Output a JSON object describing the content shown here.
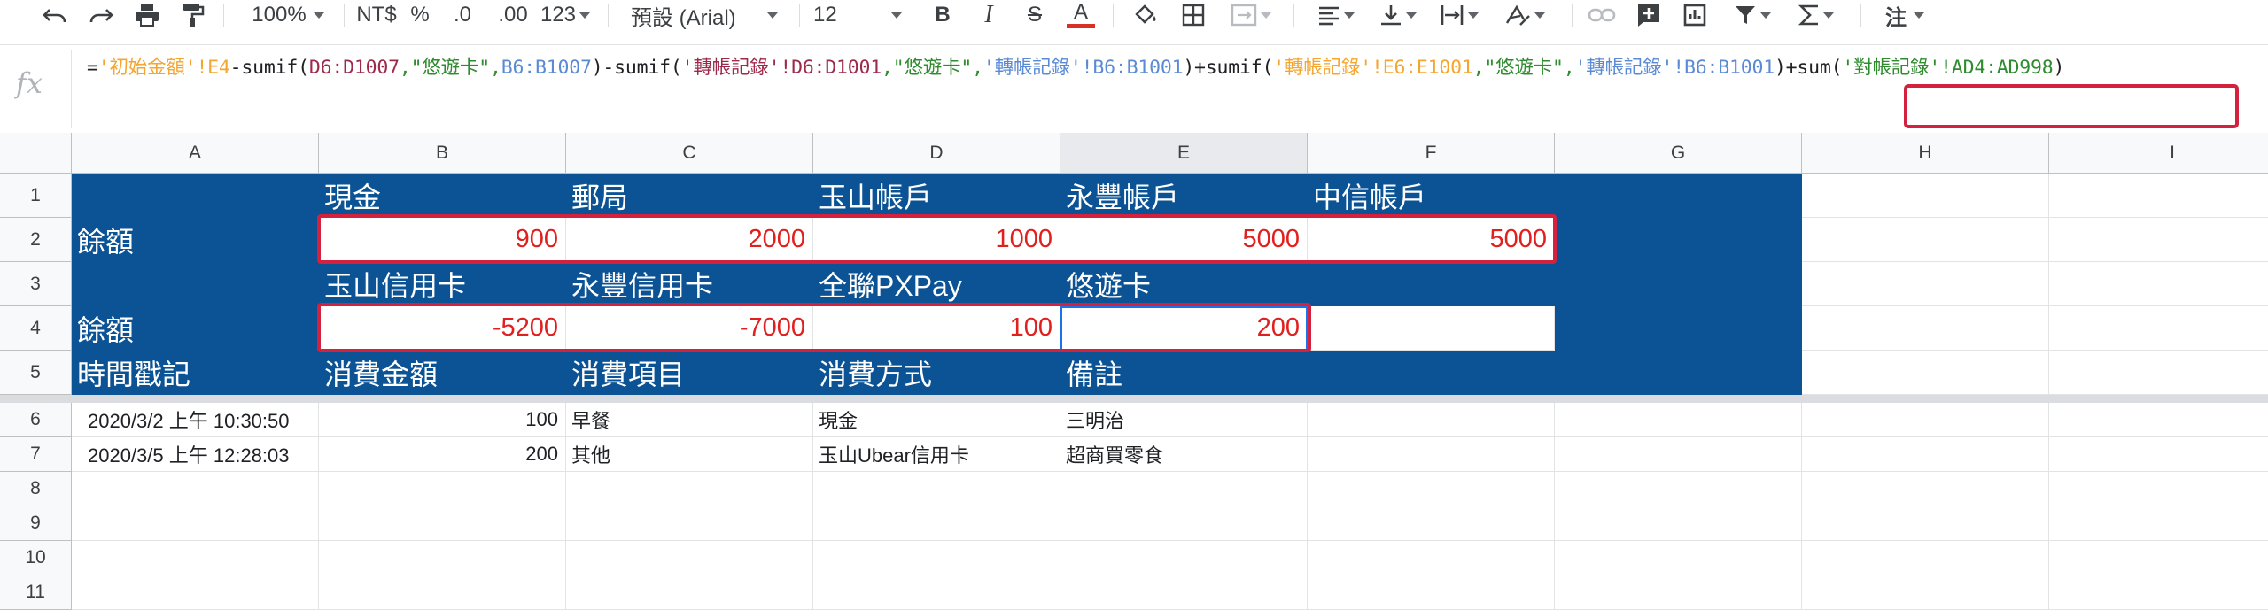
{
  "toolbar": {
    "zoom": "100%",
    "currency": "NT$",
    "percent": "%",
    "decimal_decrease": ".0",
    "decimal_increase": ".00",
    "more_formats": "123",
    "font": "預設 (Arial)",
    "font_size": "12",
    "bold": "B",
    "italic": "I",
    "strike": "S",
    "text_color_letter": "A",
    "text_color": "#d93025",
    "more": "注"
  },
  "formula_bar": {
    "fx_label": "fx",
    "segments": [
      {
        "text": "=",
        "c": "d"
      },
      {
        "text": "'初始金額'!E4",
        "c": "y"
      },
      {
        "text": "-sumif(",
        "c": "d"
      },
      {
        "text": "D6:D1007",
        "c": "m"
      },
      {
        "text": ",\"悠遊卡\",",
        "c": "g"
      },
      {
        "text": "B6:B1007",
        "c": "b"
      },
      {
        "text": ")-sumif(",
        "c": "d"
      },
      {
        "text": "'轉帳記錄'!D6:D1001",
        "c": "m"
      },
      {
        "text": ",\"悠遊卡\",",
        "c": "g"
      },
      {
        "text": "'轉帳記錄'!B6:B1001",
        "c": "b"
      },
      {
        "text": ")+sumif(",
        "c": "d"
      },
      {
        "text": "'轉帳記錄'!E6:E1001",
        "c": "y"
      },
      {
        "text": ",\"悠遊卡\",",
        "c": "g"
      },
      {
        "text": "'轉帳記錄'!B6:B1001",
        "c": "b"
      },
      {
        "text": ")+sum(",
        "c": "d"
      },
      {
        "text": "'對帳記錄'!AD4:AD998",
        "c": "g"
      },
      {
        "text": ")",
        "c": "d"
      }
    ]
  },
  "columns": [
    "A",
    "B",
    "C",
    "D",
    "E",
    "F",
    "G",
    "H",
    "I"
  ],
  "rows": [
    "1",
    "2",
    "3",
    "4",
    "5",
    "6",
    "7",
    "8",
    "9",
    "10",
    "11"
  ],
  "sheet": {
    "row1": [
      "",
      "現金",
      "郵局",
      "玉山帳戶",
      "永豐帳戶",
      "中信帳戶"
    ],
    "row2": [
      "餘額",
      "900",
      "2000",
      "1000",
      "5000",
      "5000"
    ],
    "row3": [
      "",
      "玉山信用卡",
      "永豐信用卡",
      "全聯PXPay",
      "悠遊卡",
      ""
    ],
    "row4": [
      "餘額",
      "-5200",
      "-7000",
      "100",
      "200",
      ""
    ],
    "row5": [
      "時間戳記",
      "消費金額",
      "消費項目",
      "消費方式",
      "備註"
    ],
    "row6": [
      "2020/3/2 上午 10:30:50",
      "100",
      "早餐",
      "現金",
      "三明治"
    ],
    "row7": [
      "2020/3/5 上午 12:28:03",
      "200",
      "其他",
      "玉山Ubear信用卡",
      "超商買零食"
    ]
  }
}
